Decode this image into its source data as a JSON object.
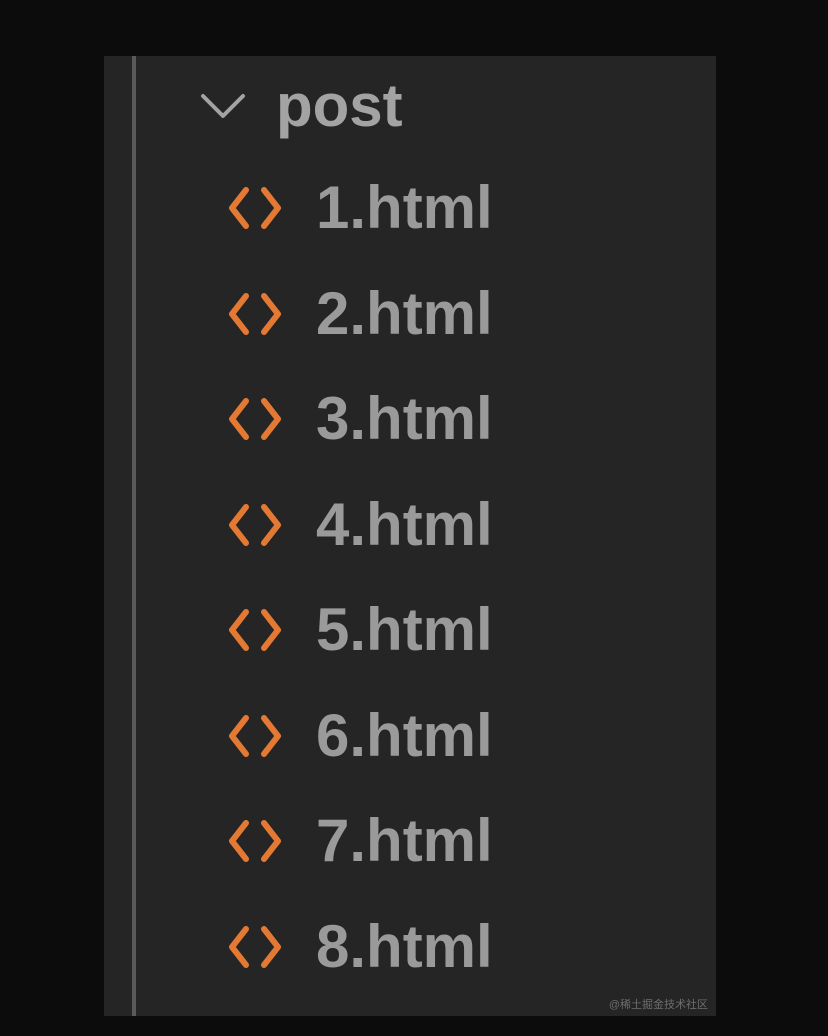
{
  "explorer": {
    "folder": {
      "label": "post",
      "icon": "chevron-down-icon",
      "expanded": true
    },
    "files": [
      {
        "label": "1.html",
        "icon": "html-code-icon"
      },
      {
        "label": "2.html",
        "icon": "html-code-icon"
      },
      {
        "label": "3.html",
        "icon": "html-code-icon"
      },
      {
        "label": "4.html",
        "icon": "html-code-icon"
      },
      {
        "label": "5.html",
        "icon": "html-code-icon"
      },
      {
        "label": "6.html",
        "icon": "html-code-icon"
      },
      {
        "label": "7.html",
        "icon": "html-code-icon"
      },
      {
        "label": "8.html",
        "icon": "html-code-icon"
      }
    ]
  },
  "watermark": "@稀土掘金技术社区",
  "colors": {
    "background": "#0c0c0c",
    "panel": "#252526",
    "text": "#9a9a9a",
    "html_icon": "#e37933",
    "indent_guide": "#5a5a5a"
  }
}
